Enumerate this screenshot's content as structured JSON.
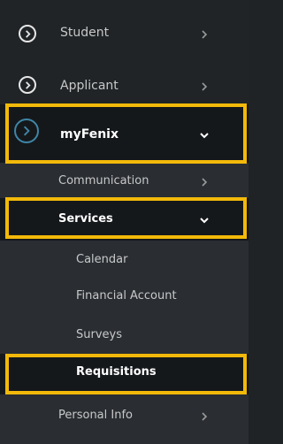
{
  "colors": {
    "background": "#202427",
    "submenu_background": "#2a2e33",
    "selected_background": "#15181b",
    "highlight": "#f3b90a",
    "icon_accent": "#3e86a7"
  },
  "menu": {
    "student": {
      "label": "Student",
      "icon": "chevron-circle-right-icon"
    },
    "applicant": {
      "label": "Applicant",
      "icon": "chevron-circle-right-icon"
    },
    "myfenix": {
      "label": "myFenix",
      "icon": "chevron-circle-right-icon"
    },
    "communication": {
      "label": "Communication"
    },
    "services": {
      "label": "Services"
    },
    "calendar": {
      "label": "Calendar"
    },
    "financial_account": {
      "label": "Financial Account"
    },
    "surveys": {
      "label": "Surveys"
    },
    "requisitions": {
      "label": "Requisitions"
    },
    "personal_info": {
      "label": "Personal Info"
    }
  }
}
